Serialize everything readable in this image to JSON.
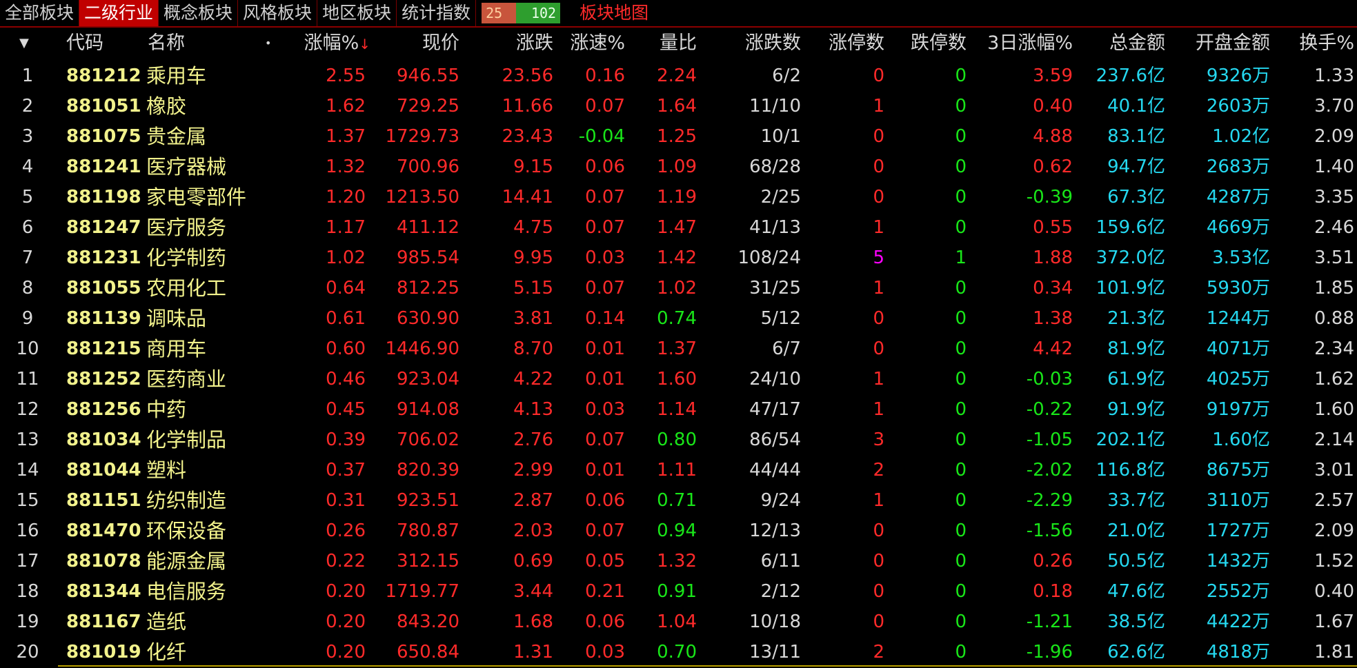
{
  "tabs": [
    "全部板块",
    "二级行业",
    "概念板块",
    "风格板块",
    "地区板块",
    "统计指数"
  ],
  "active_tab_index": 1,
  "ratio": {
    "up": "25",
    "down": "102"
  },
  "map_link": "板块地图",
  "headers": {
    "code": "代码",
    "name": "名称",
    "dot": "•",
    "pct": "涨幅%",
    "sort_arrow": "↓",
    "price": "现价",
    "change": "涨跌",
    "speed": "涨速%",
    "vol_ratio": "量比",
    "up_down": "涨跌数",
    "limit_up": "涨停数",
    "limit_down": "跌停数",
    "three_day": "3日涨幅%",
    "amount": "总金额",
    "open_amount": "开盘金额",
    "turnover": "换手%"
  },
  "colors": {
    "up": "#ff2a2a",
    "down": "#19e619",
    "flat": "#d8d8d8",
    "highlight": "#ff00ff",
    "amount": "#25d8f0",
    "name": "#f2f28c"
  },
  "rows": [
    {
      "idx": "1",
      "code": "881212",
      "name": "乘用车",
      "pct": "2.55",
      "price": "946.55",
      "chg": "23.56",
      "speed": "0.16",
      "vr": "2.24",
      "ud": "6/2",
      "lu": "0",
      "ld": "0",
      "d3": "3.59",
      "amt": "237.6亿",
      "open": "9326万",
      "turn": "1.33"
    },
    {
      "idx": "2",
      "code": "881051",
      "name": "橡胶",
      "pct": "1.62",
      "price": "729.25",
      "chg": "11.66",
      "speed": "0.07",
      "vr": "1.64",
      "ud": "11/10",
      "lu": "1",
      "ld": "0",
      "d3": "0.40",
      "amt": "40.1亿",
      "open": "2603万",
      "turn": "3.70"
    },
    {
      "idx": "3",
      "code": "881075",
      "name": "贵金属",
      "pct": "1.37",
      "price": "1729.73",
      "chg": "23.43",
      "speed": "-0.04",
      "vr": "1.25",
      "ud": "10/1",
      "lu": "0",
      "ld": "0",
      "d3": "4.88",
      "amt": "83.1亿",
      "open": "1.02亿",
      "turn": "2.09"
    },
    {
      "idx": "4",
      "code": "881241",
      "name": "医疗器械",
      "pct": "1.32",
      "price": "700.96",
      "chg": "9.15",
      "speed": "0.06",
      "vr": "1.09",
      "ud": "68/28",
      "lu": "0",
      "ld": "0",
      "d3": "0.62",
      "amt": "94.7亿",
      "open": "2683万",
      "turn": "1.40"
    },
    {
      "idx": "5",
      "code": "881198",
      "name": "家电零部件",
      "pct": "1.20",
      "price": "1213.50",
      "chg": "14.41",
      "speed": "0.07",
      "vr": "1.19",
      "ud": "2/25",
      "lu": "0",
      "ld": "0",
      "d3": "-0.39",
      "amt": "67.3亿",
      "open": "4287万",
      "turn": "3.35"
    },
    {
      "idx": "6",
      "code": "881247",
      "name": "医疗服务",
      "pct": "1.17",
      "price": "411.12",
      "chg": "4.75",
      "speed": "0.07",
      "vr": "1.47",
      "ud": "41/13",
      "lu": "1",
      "ld": "0",
      "d3": "0.55",
      "amt": "159.6亿",
      "open": "4669万",
      "turn": "2.46"
    },
    {
      "idx": "7",
      "code": "881231",
      "name": "化学制药",
      "pct": "1.02",
      "price": "985.54",
      "chg": "9.95",
      "speed": "0.03",
      "vr": "1.42",
      "ud": "108/24",
      "lu": "5",
      "ld": "1",
      "d3": "1.88",
      "amt": "372.0亿",
      "open": "3.53亿",
      "turn": "3.51"
    },
    {
      "idx": "8",
      "code": "881055",
      "name": "农用化工",
      "pct": "0.64",
      "price": "812.25",
      "chg": "5.15",
      "speed": "0.07",
      "vr": "1.02",
      "ud": "31/25",
      "lu": "1",
      "ld": "0",
      "d3": "0.34",
      "amt": "101.9亿",
      "open": "5930万",
      "turn": "1.85"
    },
    {
      "idx": "9",
      "code": "881139",
      "name": "调味品",
      "pct": "0.61",
      "price": "630.90",
      "chg": "3.81",
      "speed": "0.14",
      "vr": "0.74",
      "ud": "5/12",
      "lu": "0",
      "ld": "0",
      "d3": "1.38",
      "amt": "21.3亿",
      "open": "1244万",
      "turn": "0.88"
    },
    {
      "idx": "10",
      "code": "881215",
      "name": "商用车",
      "pct": "0.60",
      "price": "1446.90",
      "chg": "8.70",
      "speed": "0.01",
      "vr": "1.37",
      "ud": "6/7",
      "lu": "0",
      "ld": "0",
      "d3": "4.42",
      "amt": "81.9亿",
      "open": "4071万",
      "turn": "2.34"
    },
    {
      "idx": "11",
      "code": "881252",
      "name": "医药商业",
      "pct": "0.46",
      "price": "923.04",
      "chg": "4.22",
      "speed": "0.01",
      "vr": "1.60",
      "ud": "24/10",
      "lu": "1",
      "ld": "0",
      "d3": "-0.03",
      "amt": "61.9亿",
      "open": "4025万",
      "turn": "1.62"
    },
    {
      "idx": "12",
      "code": "881256",
      "name": "中药",
      "pct": "0.45",
      "price": "914.08",
      "chg": "4.13",
      "speed": "0.03",
      "vr": "1.14",
      "ud": "47/17",
      "lu": "1",
      "ld": "0",
      "d3": "-0.22",
      "amt": "91.9亿",
      "open": "9197万",
      "turn": "1.60"
    },
    {
      "idx": "13",
      "code": "881034",
      "name": "化学制品",
      "pct": "0.39",
      "price": "706.02",
      "chg": "2.76",
      "speed": "0.07",
      "vr": "0.80",
      "ud": "86/54",
      "lu": "3",
      "ld": "0",
      "d3": "-1.05",
      "amt": "202.1亿",
      "open": "1.60亿",
      "turn": "2.14"
    },
    {
      "idx": "14",
      "code": "881044",
      "name": "塑料",
      "pct": "0.37",
      "price": "820.39",
      "chg": "2.99",
      "speed": "0.01",
      "vr": "1.11",
      "ud": "44/44",
      "lu": "2",
      "ld": "0",
      "d3": "-2.02",
      "amt": "116.8亿",
      "open": "8675万",
      "turn": "3.01"
    },
    {
      "idx": "15",
      "code": "881151",
      "name": "纺织制造",
      "pct": "0.31",
      "price": "923.51",
      "chg": "2.87",
      "speed": "0.06",
      "vr": "0.71",
      "ud": "9/24",
      "lu": "1",
      "ld": "0",
      "d3": "-2.29",
      "amt": "33.7亿",
      "open": "3110万",
      "turn": "2.57"
    },
    {
      "idx": "16",
      "code": "881470",
      "name": "环保设备",
      "pct": "0.26",
      "price": "780.87",
      "chg": "2.03",
      "speed": "0.07",
      "vr": "0.94",
      "ud": "12/13",
      "lu": "0",
      "ld": "0",
      "d3": "-1.56",
      "amt": "21.0亿",
      "open": "1727万",
      "turn": "2.09"
    },
    {
      "idx": "17",
      "code": "881078",
      "name": "能源金属",
      "pct": "0.22",
      "price": "312.15",
      "chg": "0.69",
      "speed": "0.05",
      "vr": "1.32",
      "ud": "6/11",
      "lu": "0",
      "ld": "0",
      "d3": "0.26",
      "amt": "50.5亿",
      "open": "1432万",
      "turn": "1.52"
    },
    {
      "idx": "18",
      "code": "881344",
      "name": "电信服务",
      "pct": "0.20",
      "price": "1719.77",
      "chg": "3.44",
      "speed": "0.21",
      "vr": "0.91",
      "ud": "2/12",
      "lu": "0",
      "ld": "0",
      "d3": "0.18",
      "amt": "47.6亿",
      "open": "2552万",
      "turn": "0.40"
    },
    {
      "idx": "19",
      "code": "881167",
      "name": "造纸",
      "pct": "0.20",
      "price": "843.20",
      "chg": "1.68",
      "speed": "0.06",
      "vr": "1.04",
      "ud": "10/18",
      "lu": "0",
      "ld": "0",
      "d3": "-1.21",
      "amt": "38.5亿",
      "open": "4422万",
      "turn": "1.67"
    },
    {
      "idx": "20",
      "code": "881019",
      "name": "化纤",
      "pct": "0.20",
      "price": "650.84",
      "chg": "1.31",
      "speed": "0.03",
      "vr": "0.70",
      "ud": "13/11",
      "lu": "2",
      "ld": "0",
      "d3": "-1.96",
      "amt": "62.6亿",
      "open": "4818万",
      "turn": "1.81"
    }
  ]
}
